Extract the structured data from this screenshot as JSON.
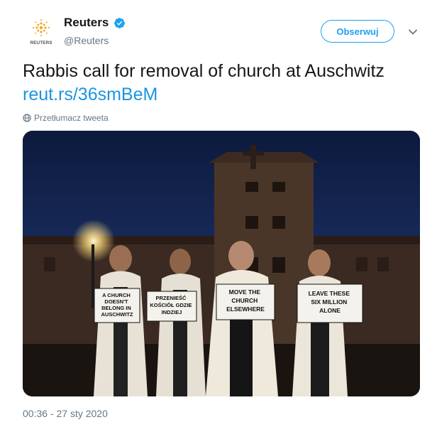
{
  "author": {
    "name": "Reuters",
    "handle": "@Reuters",
    "avatar_text": "REUTERS",
    "verified": true
  },
  "follow_label": "Obserwuj",
  "tweet": {
    "text": "Rabbis call for removal of church at Auschwitz",
    "link": "reut.rs/36smBeM"
  },
  "translate_label": "Przetłumacz tweeta",
  "timestamp": "00:36 - 27 sty 2020",
  "photo": {
    "signs": [
      "A CHURCH DOESN'T BELONG IN AUSCHWITZ",
      "PRZENIEŚĆ KOŚCIÓŁ GDZIE INDZIEJ",
      "MOVE THE CHURCH ELSEWHERE",
      "LEAVE THESE SIX MILLION ALONE"
    ]
  },
  "colors": {
    "accent": "#1da1f2",
    "link": "#1b95e0",
    "secondary_text": "#657786",
    "brand_orange": "#f5a623"
  },
  "icons": {
    "verified": "verified-badge-icon",
    "chevron": "chevron-down-icon",
    "translate": "globe-icon"
  }
}
